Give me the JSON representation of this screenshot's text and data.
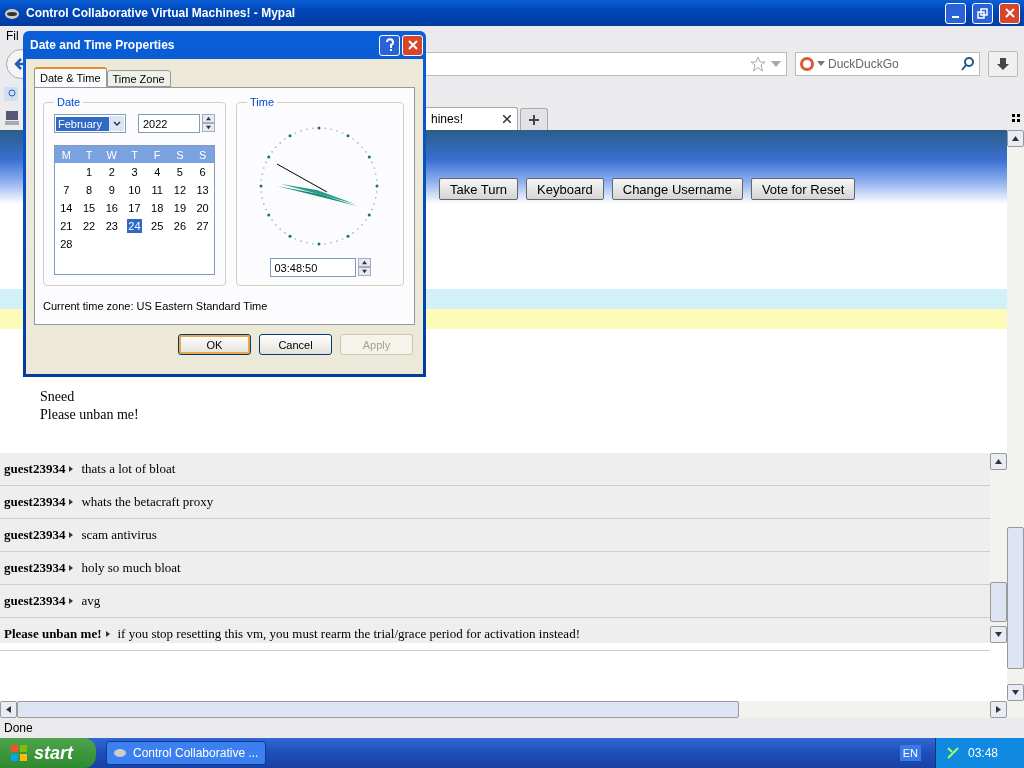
{
  "browser": {
    "title": "Control Collaborative Virtual Machines! - Mypal",
    "menu": [
      "Fil"
    ],
    "search": {
      "placeholder": "DuckDuckGo"
    },
    "tabs": [
      {
        "label": "hines!",
        "selected": true
      }
    ],
    "status": "Done"
  },
  "page": {
    "buttons": [
      "Take Turn",
      "Keyboard",
      "Change Username",
      "Vote for Reset"
    ],
    "users": [
      "Sneed",
      "Please unban me!"
    ],
    "chat": [
      {
        "user": "guest23934",
        "message": "thats a lot of bloat"
      },
      {
        "user": "guest23934",
        "message": "whats the betacraft proxy"
      },
      {
        "user": "guest23934",
        "message": "scam antivirus"
      },
      {
        "user": "guest23934",
        "message": "holy so much bloat"
      },
      {
        "user": "guest23934",
        "message": "avg"
      },
      {
        "user": "Please unban me!",
        "message": "if you stop resetting this vm, you must rearm the trial/grace period for activation instead!"
      }
    ]
  },
  "dialog": {
    "title": "Date and Time Properties",
    "tabs": [
      {
        "label": "Date & Time",
        "selected": true
      },
      {
        "label": "Time Zone",
        "selected": false
      }
    ],
    "date_group": "Date",
    "month": "February",
    "year": "2022",
    "weekdays": [
      "M",
      "T",
      "W",
      "T",
      "F",
      "S",
      "S"
    ],
    "weeks": [
      [
        {
          "day": "1",
          "selected": false
        },
        {
          "day": "2",
          "selected": false
        },
        {
          "day": "3",
          "selected": false
        },
        {
          "day": "4",
          "selected": false
        },
        {
          "day": "5",
          "selected": false
        },
        {
          "day": "6",
          "selected": false
        }
      ],
      [
        {
          "day": "7",
          "selected": false
        },
        {
          "day": "8",
          "selected": false
        },
        {
          "day": "9",
          "selected": false
        },
        {
          "day": "10",
          "selected": false
        },
        {
          "day": "11",
          "selected": false
        },
        {
          "day": "12",
          "selected": false
        },
        {
          "day": "13",
          "selected": false
        }
      ],
      [
        {
          "day": "14",
          "selected": false
        },
        {
          "day": "15",
          "selected": false
        },
        {
          "day": "16",
          "selected": false
        },
        {
          "day": "17",
          "selected": false
        },
        {
          "day": "18",
          "selected": false
        },
        {
          "day": "19",
          "selected": false
        },
        {
          "day": "20",
          "selected": false
        }
      ],
      [
        {
          "day": "21",
          "selected": false
        },
        {
          "day": "22",
          "selected": false
        },
        {
          "day": "23",
          "selected": false
        },
        {
          "day": "24",
          "selected": true
        },
        {
          "day": "25",
          "selected": false
        },
        {
          "day": "26",
          "selected": false
        },
        {
          "day": "27",
          "selected": false
        }
      ],
      [
        {
          "day": "28",
          "selected": false
        }
      ]
    ],
    "time_group": "Time",
    "time": "03:48:50",
    "time_zone_text": "Current time zone:  US Eastern Standard Time",
    "buttons": [
      {
        "label": "OK",
        "kind": "default",
        "disabled": false
      },
      {
        "label": "Cancel",
        "kind": "normal",
        "disabled": false
      },
      {
        "label": "Apply",
        "kind": "normal",
        "disabled": true
      }
    ]
  },
  "taskbar": {
    "start": "start",
    "task": "Control Collaborative ...",
    "language": "EN",
    "clock": "03:48"
  }
}
